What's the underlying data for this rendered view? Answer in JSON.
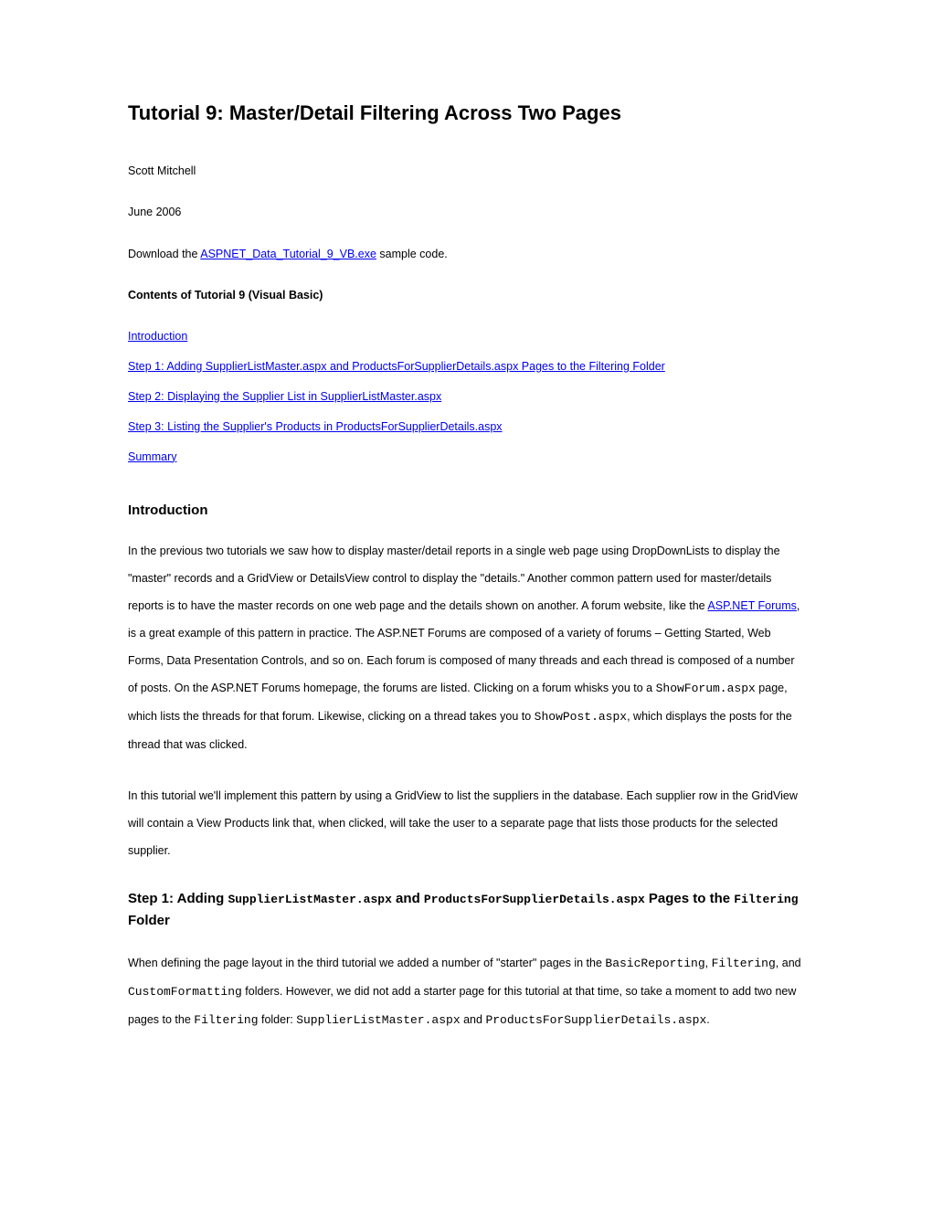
{
  "title": "Tutorial 9: Master/Detail Filtering Across Two Pages",
  "author": "Scott Mitchell",
  "date": "June 2006",
  "download": {
    "prefix": "Download the ",
    "link": "ASPNET_Data_Tutorial_9_VB.exe",
    "suffix": " sample code."
  },
  "contents_header": "Contents of Tutorial 9 (Visual Basic)",
  "toc": {
    "intro": "Introduction",
    "step1": "Step 1: Adding SupplierListMaster.aspx and ProductsForSupplierDetails.aspx Pages to the Filtering Folder ",
    "step2": "Step 2: Displaying the Supplier List in SupplierListMaster.aspx",
    "step3": "Step 3: Listing the Supplier's Products in ProductsForSupplierDetails.aspx",
    "summary": "Summary"
  },
  "intro_heading": "Introduction",
  "intro_p1": {
    "part1": "In the previous two tutorials we saw how to display master/detail reports in a single web page using DropDownLists to display the \"master\" records and a GridView or DetailsView control to display the \"details.\" Another common pattern used for master/details reports is to have the master records on one web page and the details shown on another. A forum website, like the ",
    "link": "ASP.NET Forums",
    "part2": ", is a great example of this pattern in practice. The ASP.NET Forums are composed of a variety of forums – Getting Started, Web Forms, Data Presentation Controls, and so on. Each forum is composed of many threads and each thread is composed of a number of posts. On the ASP.NET Forums homepage, the forums are listed. Clicking on a forum whisks you to a ",
    "code1": "ShowForum.aspx",
    "part3": " page, which lists the threads for that forum. Likewise, clicking on a thread takes you to ",
    "code2": "ShowPost.aspx",
    "part4": ", which displays the posts for the thread that was clicked."
  },
  "intro_p2": "In this tutorial we'll implement this pattern by using a GridView to list the suppliers in the database. Each supplier row in the GridView will contain a View Products link that, when clicked, will take the user to a separate page that lists those products for the selected supplier.",
  "step1_heading": {
    "t1": "Step 1: Adding ",
    "c1": "SupplierListMaster.aspx",
    "t2": " and ",
    "c2": "ProductsForSupplierDetails.aspx",
    "t3": " Pages to the ",
    "c3": "Filtering",
    "t4": " Folder"
  },
  "step1_p1": {
    "t1": "When defining the page layout in the third tutorial we added a number of \"starter\" pages in the ",
    "c1": "BasicReporting",
    "t2": ", ",
    "c2": "Filtering",
    "t3": ", and ",
    "c3": "CustomFormatting",
    "t4": " folders. However, we did not add a starter page for this tutorial at that time, so take a moment to add two new pages to the ",
    "c4": "Filtering",
    "t5": " folder: ",
    "c5": "SupplierListMaster.aspx",
    "t6": " and ",
    "c6": "ProductsForSupplierDetails.aspx",
    "t7": "."
  }
}
